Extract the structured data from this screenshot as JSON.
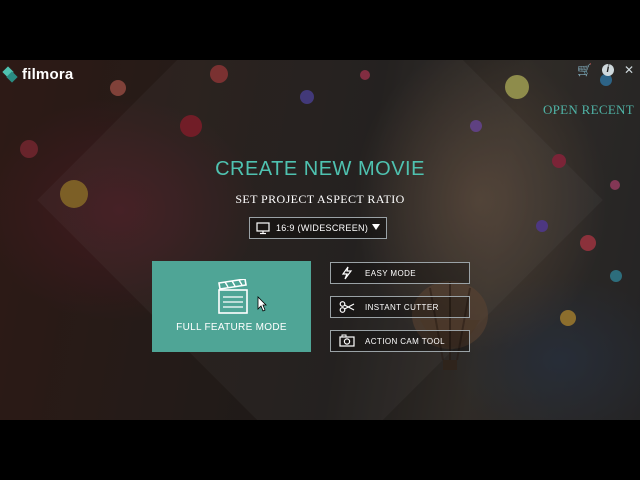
{
  "app": {
    "name": "filmora"
  },
  "titlebar": {
    "icons": [
      "cart-icon",
      "info-icon",
      "close-icon"
    ],
    "cart_glyph": "🛒",
    "info_glyph": "i",
    "close_glyph": "✕",
    "open_recent": "OPEN RECENT"
  },
  "main": {
    "headline": "CREATE NEW MOVIE",
    "subhead": "SET PROJECT ASPECT RATIO",
    "aspect": {
      "selected": "16:9  (WIDESCREEN)"
    },
    "full_feature_label": "FULL FEATURE MODE",
    "modes": [
      {
        "label": "EASY MODE",
        "icon": "lightning-icon"
      },
      {
        "label": "INSTANT CUTTER",
        "icon": "scissors-icon"
      },
      {
        "label": "ACTION CAM TOOL",
        "icon": "camera-icon"
      }
    ]
  },
  "colors": {
    "accent": "#4fc2b0",
    "full_mode_bg": "#4fa596",
    "border": "#9aa2a6"
  }
}
